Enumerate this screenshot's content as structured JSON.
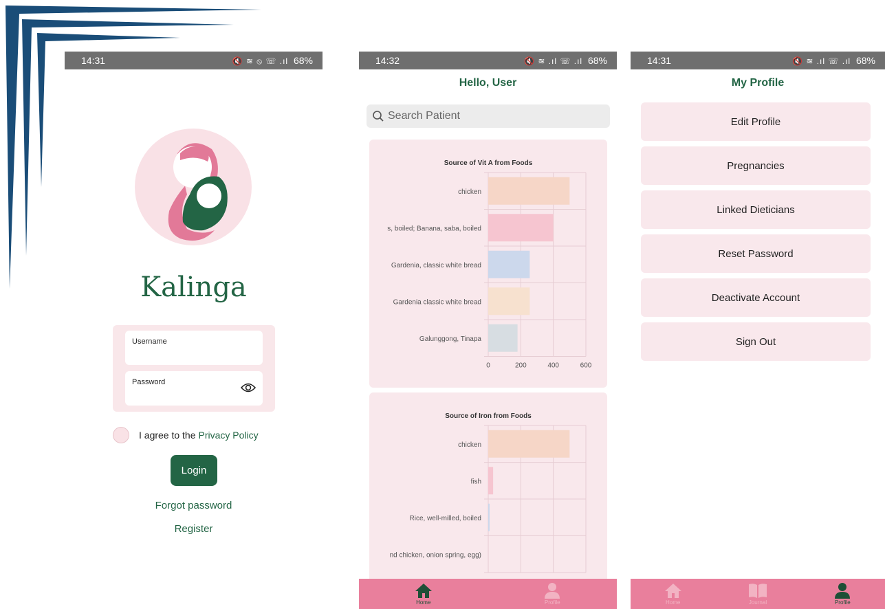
{
  "screens": {
    "login": {
      "status": {
        "time": "14:31",
        "icons": "🔇 ≋ ⦸ ☏ .ıl",
        "battery": "68%"
      },
      "brand": "Kalinga",
      "username_label": "Username",
      "password_label": "Password",
      "agree_text": "I agree to the",
      "privacy_link": "Privacy Policy",
      "login_button": "Login",
      "forgot_link": "Forgot password",
      "register_link": "Register"
    },
    "home": {
      "status": {
        "time": "14:32",
        "icons": "🔇 ≋ .ıl ☏ .ıl",
        "battery": "68%"
      },
      "greeting": "Hello, User",
      "search_placeholder": "Search Patient",
      "nav": {
        "home": "Home",
        "profile": "Profile"
      }
    },
    "profile": {
      "status": {
        "time": "14:31",
        "icons": "🔇 ≋ .ıl ☏ .ıl",
        "battery": "68%"
      },
      "title": "My Profile",
      "menu": [
        "Edit Profile",
        "Pregnancies",
        "Linked Dieticians",
        "Reset Password",
        "Deactivate Account",
        "Sign Out"
      ],
      "nav": {
        "home": "Home",
        "journal": "Journal",
        "profile": "Profile"
      }
    }
  },
  "colors": {
    "brand_green": "#236545",
    "pink_card": "#f9e8ec",
    "nav_pink": "#e97f9c"
  },
  "chart_data": [
    {
      "type": "bar",
      "orientation": "horizontal",
      "title": "Source of Vit A from Foods",
      "categories": [
        "chicken",
        "s, boiled; Banana, saba, boiled",
        "Gardenia, classic white bread",
        "Gardenia classic white bread",
        "Galunggong, Tinapa"
      ],
      "values": [
        500,
        400,
        255,
        255,
        180
      ],
      "bar_colors": [
        "#f6d6c7",
        "#f6c5d0",
        "#ccd8ec",
        "#f7e1cf",
        "#d7dde2"
      ],
      "xlim": [
        0,
        600
      ],
      "xticks": [
        0,
        200,
        400,
        600
      ],
      "grid": true
    },
    {
      "type": "bar",
      "orientation": "horizontal",
      "title": "Source of Iron from Foods",
      "categories": [
        "chicken",
        "fish",
        "Rice, well-milled, boiled",
        "nd chicken, onion spring, egg)"
      ],
      "values": [
        500,
        30,
        5,
        0
      ],
      "bar_colors": [
        "#f6d6c7",
        "#f6c5d0",
        "#ccd8ec",
        "#f7e1cf"
      ],
      "xlim": [
        0,
        600
      ],
      "grid": true
    }
  ]
}
